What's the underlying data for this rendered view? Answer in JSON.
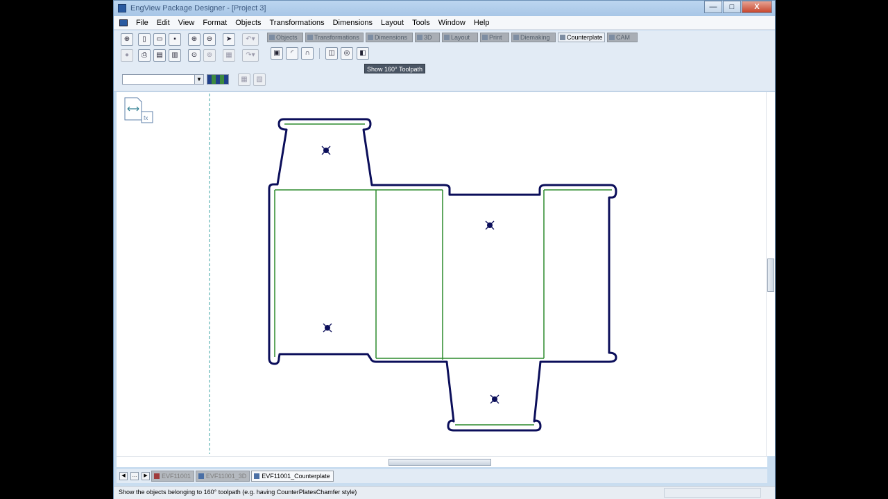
{
  "window": {
    "title": "EngView Package Designer - [Project 3]",
    "buttons": {
      "minimize": "—",
      "maximize": "□",
      "close": "X"
    }
  },
  "menu": [
    "File",
    "Edit",
    "View",
    "Format",
    "Objects",
    "Transformations",
    "Dimensions",
    "Layout",
    "Tools",
    "Window",
    "Help"
  ],
  "tabs": [
    "Objects",
    "Transformations",
    "Dimensions",
    "3D",
    "Layout",
    "Print",
    "Diemaking",
    "Counterplate",
    "CAM"
  ],
  "active_tab": "Counterplate",
  "tooltip": "Show 160° Toolpath",
  "combo_value": "",
  "doc_tabs": [
    "EVF11001",
    "EVF11001_3D",
    "EVF11001_Counterplate"
  ],
  "active_doc_tab": "EVF11001_Counterplate",
  "status": "Show the objects belonging to 160° toolpath (e.g. having CounterPlatesChamfer style)",
  "colors": {
    "outline": "#0b0e5a",
    "crease": "#2b8a2b",
    "guide": "#3aa3a3"
  }
}
